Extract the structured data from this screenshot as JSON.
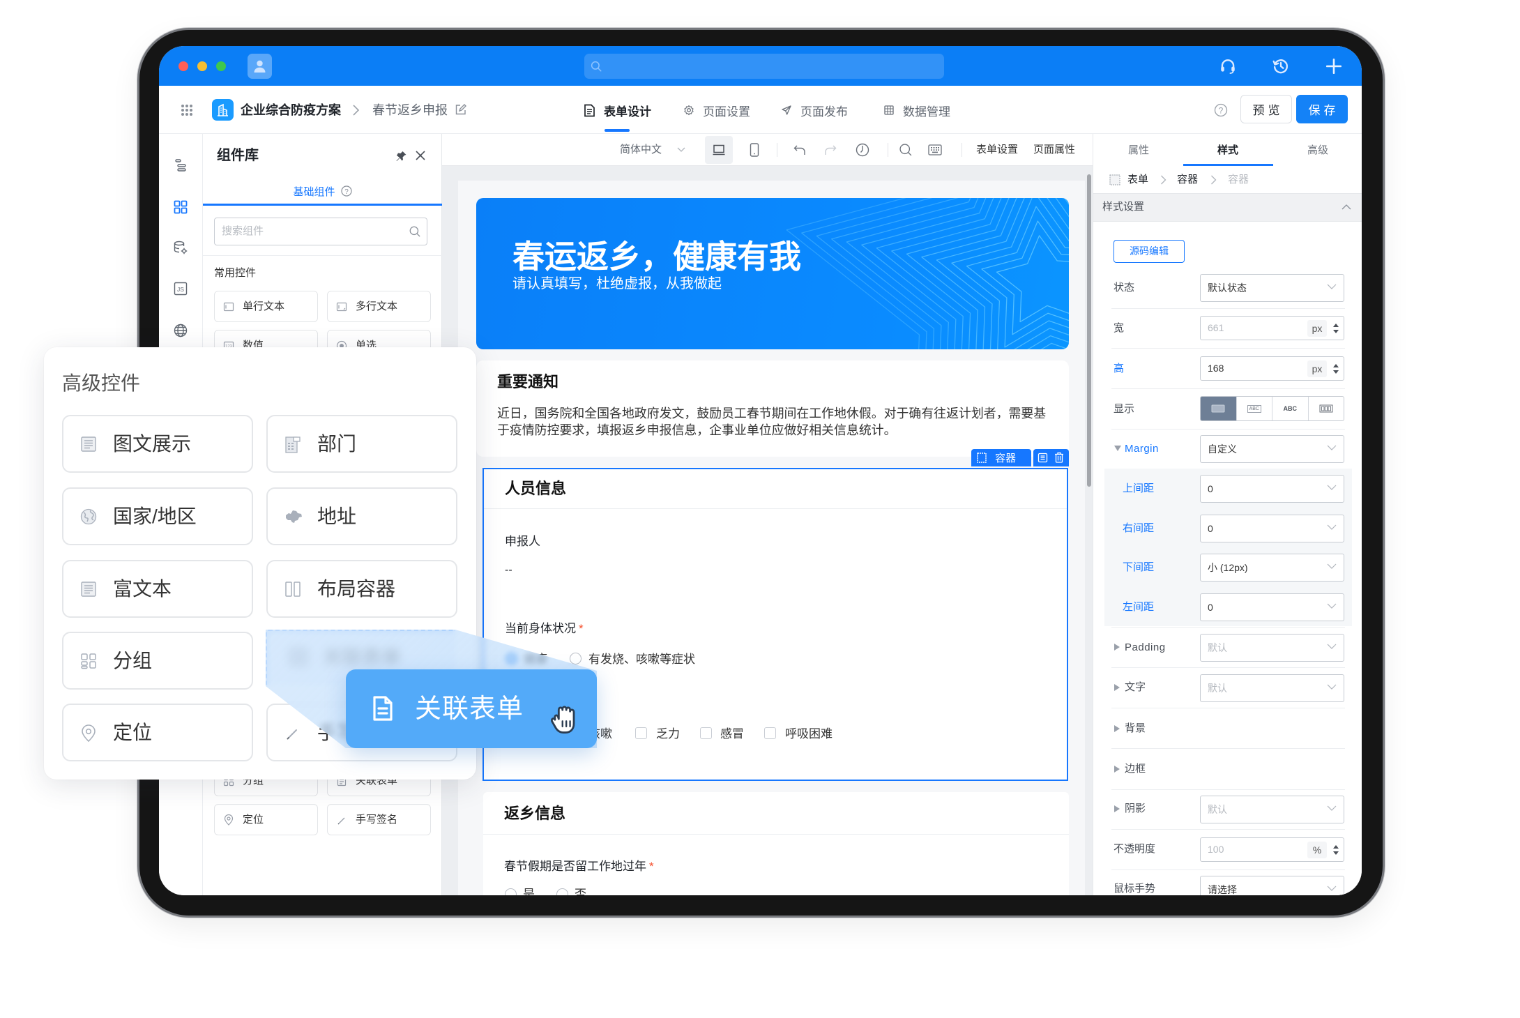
{
  "titlebar": {
    "icons": [
      "window-close",
      "window-minimize",
      "window-maximize",
      "user-avatar-icon",
      "search-icon",
      "headset-icon",
      "history-icon",
      "plus-icon"
    ]
  },
  "header": {
    "app_name": "企业综合防疫方案",
    "page_name": "春节返乡申报",
    "tabs": [
      {
        "label": "表单设计",
        "icon": "form-doc-icon",
        "active": true
      },
      {
        "label": "页面设置",
        "icon": "gear-icon",
        "active": false
      },
      {
        "label": "页面发布",
        "icon": "send-icon",
        "active": false
      },
      {
        "label": "数据管理",
        "icon": "table-icon",
        "active": false
      }
    ],
    "preview_label": "预览",
    "save_label": "保存"
  },
  "component_panel": {
    "title": "组件库",
    "tab_label": "基础组件",
    "search_placeholder": "搜索组件",
    "group_label": "常用控件",
    "items": [
      {
        "label": "单行文本",
        "icon": "single-line-icon"
      },
      {
        "label": "多行文本",
        "icon": "multi-line-icon"
      },
      {
        "label": "数值",
        "icon": "number-icon"
      },
      {
        "label": "单选",
        "icon": "radio-icon"
      },
      {
        "label": "分组",
        "icon": "group-icon"
      },
      {
        "label": "关联表单",
        "icon": "related-form-icon"
      },
      {
        "label": "定位",
        "icon": "location-icon"
      },
      {
        "label": "手写签名",
        "icon": "signature-icon"
      }
    ]
  },
  "toolbar": {
    "language": "简体中文",
    "form_settings": "表单设置",
    "page_properties": "页面属性",
    "active_device": "desktop"
  },
  "canvas": {
    "banner": {
      "title": "春运返乡，健康有我",
      "subtitle": "请认真填写，杜绝虚报，从我做起",
      "color": "#0a84ff"
    },
    "notice": {
      "title": "重要通知",
      "lines": [
        "近日，国务院和全国各地政府发文，鼓励员工春节期间在工作地休假。对于确有往返计划者，需要基",
        "于疫情防控要求，填报返乡申报信息，企事业单位应做好相关信息统计。"
      ]
    },
    "selection_tag": "容器",
    "person_section": {
      "title": "人员信息",
      "reporter_label": "申报人",
      "reporter_value": "--",
      "health_label": "当前身体状况",
      "health_required": "*",
      "health_options": [
        "健康",
        "有发烧、咳嗽等症状"
      ],
      "health_selected": 0,
      "symptom_options": [
        "咳嗽",
        "乏力",
        "感冒",
        "呼吸困难"
      ]
    },
    "return_section": {
      "title": "返乡信息",
      "stay_label": "春节假期是否留工作地过年",
      "stay_required": "*",
      "stay_options": [
        "是",
        "否"
      ]
    }
  },
  "props_panel": {
    "tabs": [
      "属性",
      "样式",
      "高级"
    ],
    "active_tab": 1,
    "breadcrumb": [
      "表单",
      "容器",
      "容器"
    ],
    "section_title": "样式设置",
    "source_edit_label": "源码编辑",
    "state": {
      "label": "状态",
      "value": "默认状态"
    },
    "width": {
      "label": "宽",
      "placeholder": "661",
      "unit": "px"
    },
    "height": {
      "label": "高",
      "value": "168",
      "unit": "px"
    },
    "display": {
      "label": "显示",
      "segments": [
        "",
        "ABC",
        "ABC",
        ""
      ],
      "selected": 0
    },
    "margin": {
      "label": "Margin",
      "value": "自定义",
      "children": [
        {
          "label": "上间距",
          "value": "0"
        },
        {
          "label": "右间距",
          "value": "0"
        },
        {
          "label": "下间距",
          "value": "小 (12px)"
        },
        {
          "label": "左间距",
          "value": "0"
        }
      ]
    },
    "padding": {
      "label": "Padding",
      "placeholder": "默认"
    },
    "text": {
      "label": "文字",
      "placeholder": "默认"
    },
    "background": {
      "label": "背景"
    },
    "border": {
      "label": "边框"
    },
    "shadow": {
      "label": "阴影",
      "placeholder": "默认"
    },
    "opacity": {
      "label": "不透明度",
      "placeholder": "100",
      "unit": "%"
    },
    "cursor": {
      "label": "鼠标手势",
      "value": "请选择"
    }
  },
  "advanced_panel": {
    "title": "高级控件",
    "items": [
      {
        "label": "图文展示",
        "icon": "image-text-icon"
      },
      {
        "label": "部门",
        "icon": "department-icon"
      },
      {
        "label": "国家/地区",
        "icon": "globe-icon"
      },
      {
        "label": "地址",
        "icon": "map-icon"
      },
      {
        "label": "富文本",
        "icon": "rich-text-icon"
      },
      {
        "label": "布局容器",
        "icon": "layout-container-icon"
      },
      {
        "label": "分组",
        "icon": "group-icon"
      },
      {
        "label": "关联表单",
        "icon": "related-form-icon",
        "state": "dragging-placeholder"
      },
      {
        "label": "定位",
        "icon": "location-icon"
      },
      {
        "label": "手写签名",
        "icon": "signature-icon"
      }
    ]
  },
  "drag_ghost": {
    "label": "关联表单",
    "icon": "related-form-icon",
    "cursor": "grab-hand-icon",
    "color": "#53aaf9"
  }
}
